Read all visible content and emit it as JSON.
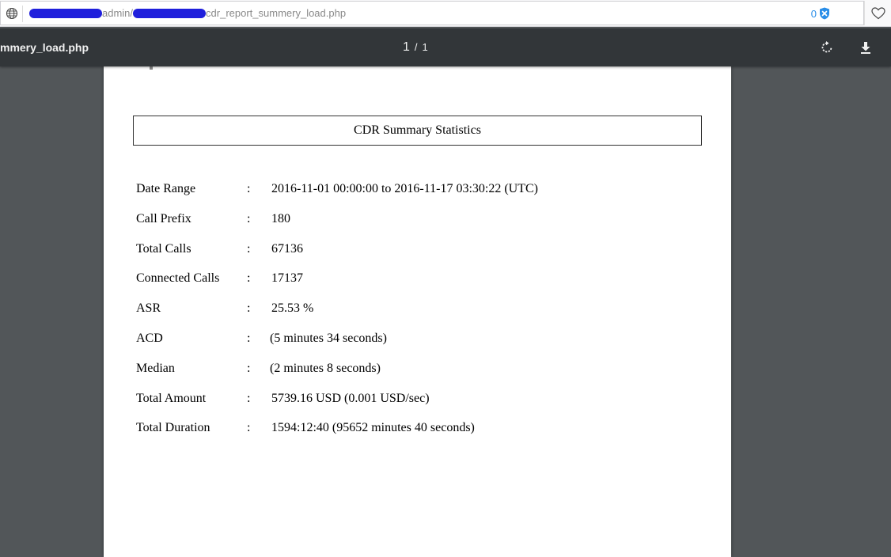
{
  "browser": {
    "url_visible_parts": [
      "admin/",
      "cdr_report_summery_load.php"
    ],
    "tracker_count": "0",
    "icons": {
      "site": "globe-icon",
      "tracker": "shield-icon",
      "favorite": "heart-icon"
    }
  },
  "pdf_viewer": {
    "title": "mmery_load.php",
    "current_page": "1",
    "page_separator": "/",
    "total_pages": "1",
    "icons": {
      "rotate": "rotate-icon",
      "download": "download-icon"
    }
  },
  "document": {
    "title": "CDR Summary Statistics",
    "separator": ":",
    "stats": [
      {
        "label": "Date Range",
        "value": "2016-11-01 00:00:00 to 2016-11-17 03:30:22 (UTC)"
      },
      {
        "label": "Call Prefix",
        "value": "180"
      },
      {
        "label": "Total Calls",
        "value": "67136"
      },
      {
        "label": "Connected Calls",
        "value": "17137"
      },
      {
        "label": "ASR",
        "value": "25.53 %"
      },
      {
        "label": "ACD",
        "value": "(5 minutes 34 seconds)"
      },
      {
        "label": "Median",
        "value": "(2 minutes 8 seconds)"
      },
      {
        "label": "Total Amount",
        "value": "5739.16 USD (0.001 USD/sec)"
      },
      {
        "label": "Total Duration",
        "value": "1594:12:40 (95652 minutes 40 seconds)"
      }
    ]
  },
  "colors": {
    "toolbar_bg": "#323639",
    "viewer_bg": "#525659",
    "redaction": "#1f1fdc",
    "logo_green": "#6aa52a",
    "tracker_blue": "#2a8ee8"
  }
}
